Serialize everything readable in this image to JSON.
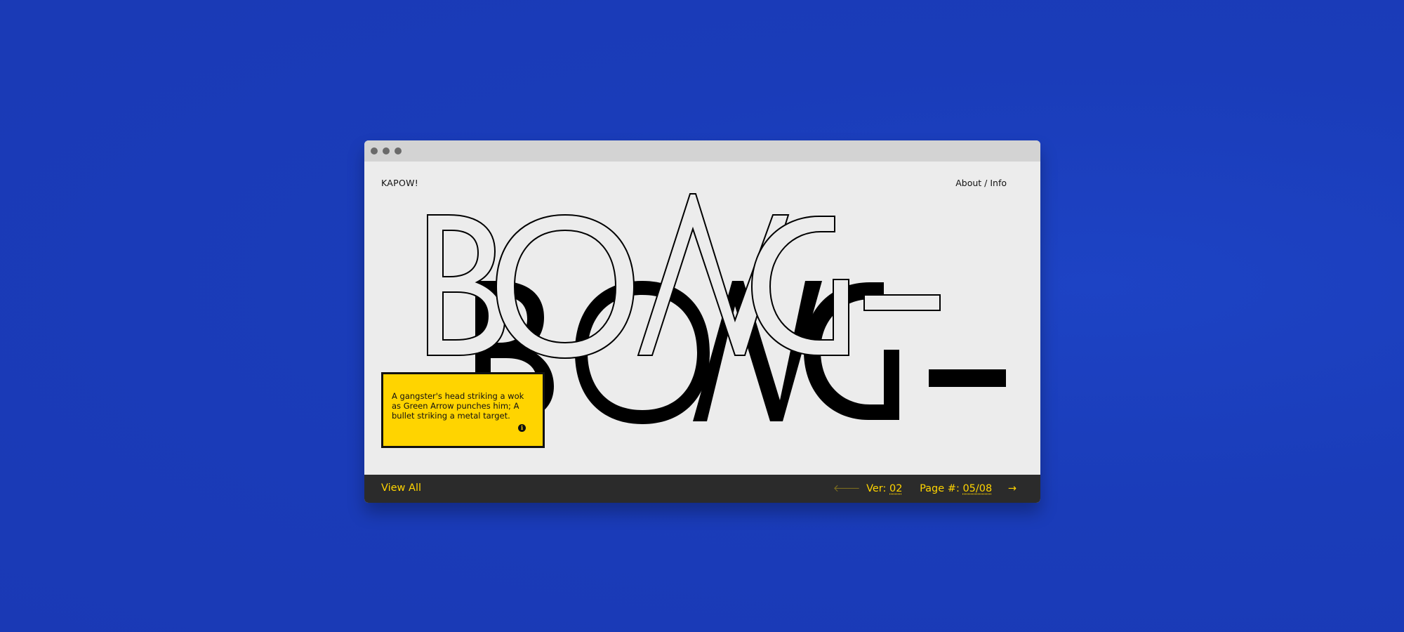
{
  "app": {
    "brand": "KAPOW!",
    "nav_about": "About / Info"
  },
  "artwork": {
    "word": "BONG",
    "description_icon": "bong-typographic-outline-and-shadow"
  },
  "caption": {
    "text": "A gangster's head striking a wok as Green Arrow punches him; A bullet striking a metal target.",
    "icon": "info-icon"
  },
  "footer": {
    "view_all": "View All",
    "prev_icon": "arrow-left-icon",
    "ver_label": "Ver:",
    "ver_value": "02",
    "page_label": "Page #:",
    "page_value": "05/08",
    "next_icon": "arrow-right-icon"
  },
  "colors": {
    "background": "#1a3ab8",
    "window": "#ececec",
    "accent": "#ffd400",
    "footer": "#2b2b2b"
  }
}
